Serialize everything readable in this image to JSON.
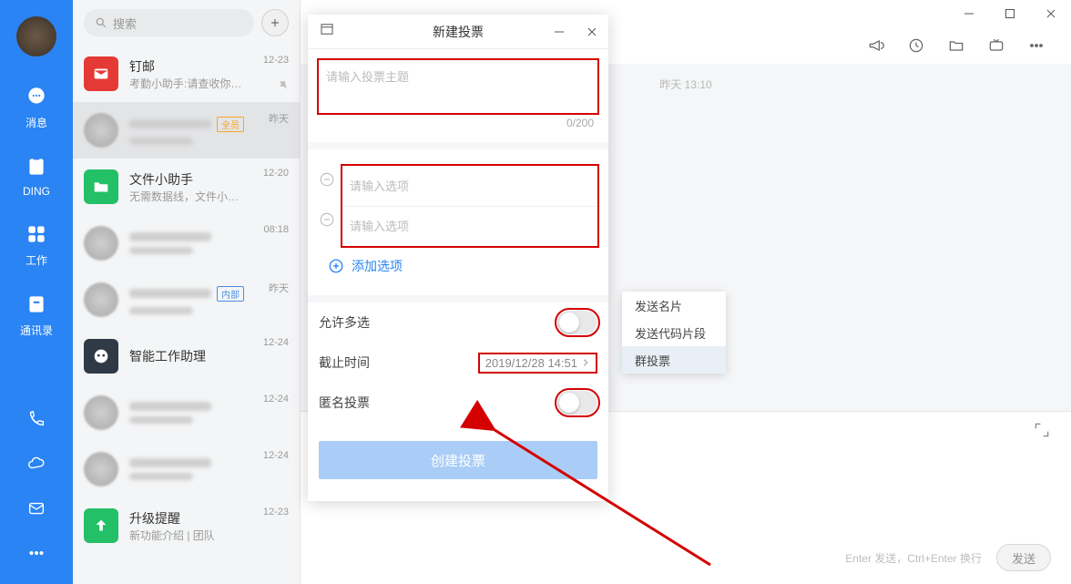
{
  "rail": {
    "items": [
      {
        "icon": "message",
        "label": "消息"
      },
      {
        "icon": "ding",
        "label": "DING"
      },
      {
        "icon": "work",
        "label": "工作"
      },
      {
        "icon": "contacts",
        "label": "通讯录"
      }
    ]
  },
  "search": {
    "placeholder": "搜索"
  },
  "conversations": [
    {
      "kind": "app",
      "color": "#e53935",
      "icon": "mail",
      "title": "钉邮",
      "sub": "考勤小助手:请查收你…",
      "time": "12-23",
      "muted": true
    },
    {
      "kind": "blur",
      "tag": "全员",
      "tag_color": "#f6a623",
      "time": "昨天"
    },
    {
      "kind": "app",
      "color": "#23c067",
      "icon": "folder",
      "title": "文件小助手",
      "sub": "无需数据线，文件小…",
      "time": "12-20"
    },
    {
      "kind": "blur",
      "time": "08:18"
    },
    {
      "kind": "blur",
      "tag": "内部",
      "tag_color": "#4a90e2",
      "time": "昨天"
    },
    {
      "kind": "app",
      "color": "#2f3a46",
      "icon": "robot",
      "title": "智能工作助理",
      "time": "12-24"
    },
    {
      "kind": "blur",
      "time": "12-24"
    },
    {
      "kind": "blur",
      "time": "12-24"
    },
    {
      "kind": "app",
      "color": "#23c067",
      "icon": "upgrade",
      "title": "升级提醒",
      "sub": "新功能介绍 | 团队",
      "time": "12-23"
    }
  ],
  "chat": {
    "timestamp": "昨天 13:10",
    "compose_hint": "Enter 发送，Ctrl+Enter 换行",
    "send": "发送"
  },
  "modal": {
    "title": "新建投票",
    "topic_placeholder": "请输入投票主题",
    "counter": "0/200",
    "option_placeholder": "请输入选项",
    "add_option": "添加选项",
    "multi": "允许多选",
    "deadline_label": "截止时间",
    "deadline_value": "2019/12/28 14:51",
    "anonymous": "匿名投票",
    "create": "创建投票"
  },
  "popup": {
    "items": [
      "发送名片",
      "发送代码片段",
      "群投票"
    ],
    "active_index": 2
  }
}
